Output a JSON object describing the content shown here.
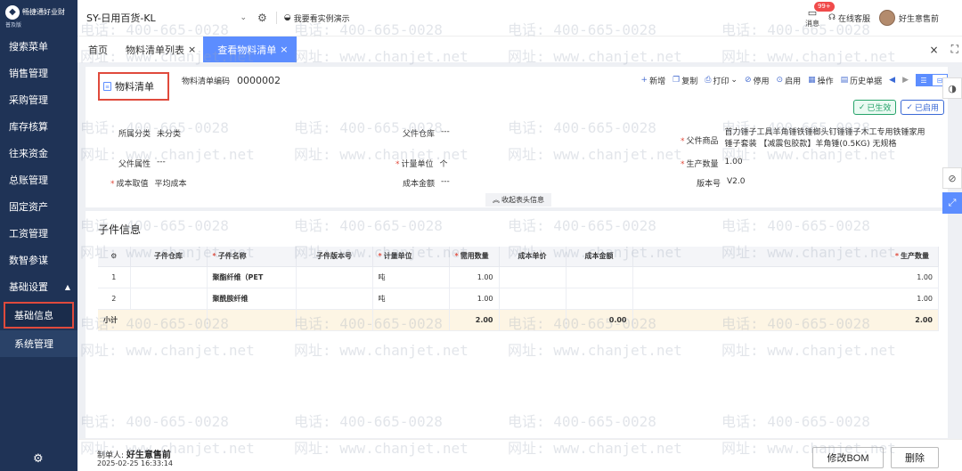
{
  "sidebar": {
    "logo_name": "畅捷通好业财",
    "logo_edition": "普及版",
    "items": [
      "搜索菜单",
      "销售管理",
      "采购管理",
      "库存核算",
      "往来资金",
      "总账管理",
      "固定资产",
      "工资管理",
      "数智参谋"
    ],
    "group": "基础设置",
    "subitems": [
      "基础信息",
      "系统管理"
    ]
  },
  "topbar": {
    "org": "SY-日用百货-KL",
    "demo": "我要看实例演示",
    "msg_badge": "99+",
    "msg_label": "消息",
    "service": "在线客服",
    "user": "好生意售前"
  },
  "tabs": {
    "home": "首页",
    "list": "物料清单列表",
    "active": "查看物料清单"
  },
  "doc": {
    "title": "物料清单",
    "code_label": "物料清单编码",
    "code_value": "0000002"
  },
  "toolbar": [
    "新增",
    "复制",
    "打印",
    "停用",
    "启用",
    "操作",
    "历史单据"
  ],
  "status": {
    "effective": "已生效",
    "enabled": "已启用"
  },
  "fields": {
    "category_label": "所属分类",
    "category_value": "未分类",
    "warehouse_label": "父件仓库",
    "warehouse_value": "---",
    "product_label": "父件商品",
    "product_value_1": "首力锤子工具羊角锤铁锤榔头钉锤锤子木工专用铁锤家用",
    "product_value_2": "锤子套装 【减震包胶款】羊角锤(0.5KG) 无规格",
    "attr_label": "父件属性",
    "attr_value": "---",
    "unit_label": "计量单位",
    "unit_value": "个",
    "qty_label": "生产数量",
    "qty_value": "1.00",
    "cost_label": "成本取值",
    "cost_value": "平均成本",
    "amount_label": "成本金额",
    "amount_value": "---",
    "version_label": "版本号",
    "version_value": "V2.0",
    "collapse": "收起表头信息"
  },
  "sub": {
    "title": "子件信息",
    "headers": [
      "子件仓库",
      "子件名称",
      "子件版本号",
      "计量单位",
      "需用数量",
      "成本单价",
      "成本金额",
      "生产数量"
    ],
    "rows": [
      {
        "no": "1",
        "warehouse": "",
        "name": "聚酯纤维（PET",
        "version": "",
        "unit": "吨",
        "qty": "1.00",
        "price": "",
        "amount": "",
        "prod": "1.00"
      },
      {
        "no": "2",
        "warehouse": "",
        "name": "聚酰胺纤维",
        "version": "",
        "unit": "吨",
        "qty": "1.00",
        "price": "",
        "amount": "",
        "prod": "1.00"
      }
    ],
    "total": {
      "label": "小计",
      "qty": "2.00",
      "amount": "0.00",
      "prod": "2.00"
    }
  },
  "footer": {
    "maker_label": "制单人:",
    "maker_name": "好生意售前",
    "time": "2025-02-25 16:33:14",
    "edit_btn": "修改BOM",
    "delete_btn": "删除"
  },
  "watermark": {
    "phone": "电话: 400-665-0028",
    "site": "网址: www.chanjet.net"
  },
  "colors": {
    "sidebar": "#1f3356",
    "accent": "#5c8dff",
    "required": "#e04a3c",
    "total_row": "#fdf5e4"
  }
}
